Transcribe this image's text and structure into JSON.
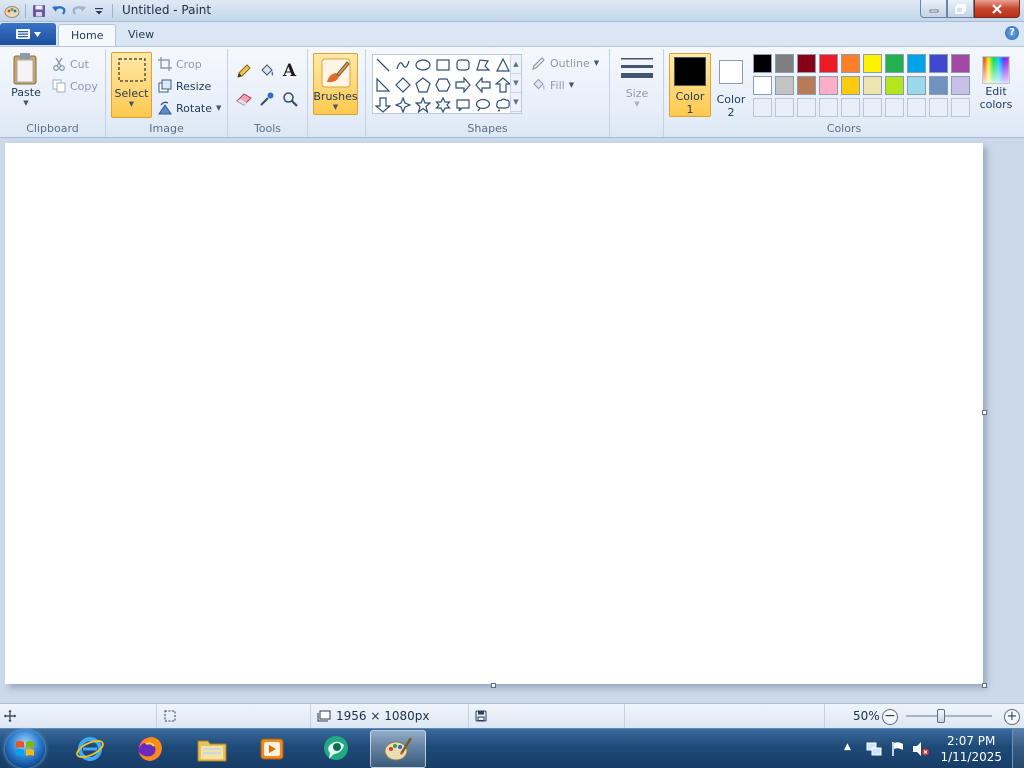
{
  "window": {
    "title": "Untitled - Paint"
  },
  "tabs": [
    {
      "label": "Home"
    },
    {
      "label": "View"
    }
  ],
  "clipboard": {
    "group_label": "Clipboard",
    "paste": "Paste",
    "cut": "Cut",
    "copy": "Copy"
  },
  "image": {
    "group_label": "Image",
    "select": "Select",
    "crop": "Crop",
    "resize": "Resize",
    "rotate": "Rotate"
  },
  "tools": {
    "group_label": "Tools"
  },
  "brushes": {
    "label": "Brushes"
  },
  "shapes": {
    "group_label": "Shapes",
    "outline": "Outline",
    "fill": "Fill"
  },
  "size": {
    "label": "Size"
  },
  "colors": {
    "group_label": "Colors",
    "color1_line1": "Color",
    "color1_line2": "1",
    "color2_line1": "Color",
    "color2_line2": "2",
    "edit_line1": "Edit",
    "edit_line2": "colors",
    "color1_value": "#000000",
    "color2_value": "#ffffff",
    "row1": [
      "#000000",
      "#7f7f7f",
      "#880015",
      "#ed1c24",
      "#ff7f27",
      "#fff200",
      "#22b14c",
      "#00a2e8",
      "#3f48cc",
      "#a349a4"
    ],
    "row2": [
      "#ffffff",
      "#c3c3c3",
      "#b97a57",
      "#ffaec9",
      "#ffc90e",
      "#efe4b0",
      "#b5e61d",
      "#99d9ea",
      "#7092be",
      "#c8bfe7"
    ]
  },
  "status": {
    "canvas_size": "1956 × 1080px",
    "zoom": "50%",
    "zoom_level_fraction": 0.5
  },
  "taskbar": {
    "time": "2:07 PM",
    "date": "1/11/2025"
  }
}
